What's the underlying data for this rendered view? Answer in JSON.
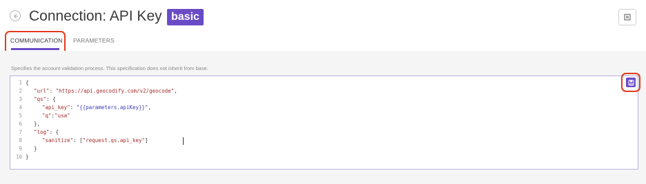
{
  "header": {
    "title": "Connection: API Key",
    "badge": "basic"
  },
  "tabs": [
    {
      "label": "COMMUNICATION",
      "active": true
    },
    {
      "label": "PARAMETERS",
      "active": false
    }
  ],
  "description": "Specifies the account validation process. This specification does not inherit from base.",
  "editor": {
    "line_numbers": [
      "1",
      "2",
      "3",
      "4",
      "5",
      "6",
      "7",
      "8",
      "9",
      "10"
    ],
    "tokens": {
      "l1_open": "{",
      "l2_key": "\"url\"",
      "l2_sep": ": ",
      "l2_val": "\"https://api.geocodify.com/v2/geocode\"",
      "l2_end": ",",
      "l3_key": "\"qs\"",
      "l3_sep": ": {",
      "l4_key": "\"api_key\"",
      "l4_sep": ": ",
      "l4_val": "\"{{parameters.apiKey}}\"",
      "l4_end": ",",
      "l5_key": "\"q\"",
      "l5_sep": ":",
      "l5_val": "\"usa\"",
      "l6": "},",
      "l7_key": "\"log\"",
      "l7_sep": ": {",
      "l8_key": "\"sanitize\"",
      "l8_sep": ": [",
      "l8_val": "\"request.qs.api_key\"",
      "l8_end": "]",
      "l9": "}",
      "l10": "}"
    }
  },
  "icons": {
    "back": "circle-arrow-left-icon",
    "doc": "document-icon",
    "save": "floppy-disk-icon"
  },
  "colors": {
    "accent": "#6a4bc6",
    "highlight": "#e23a1c",
    "string": "#a52a2a",
    "template": "#3b3bb8"
  }
}
